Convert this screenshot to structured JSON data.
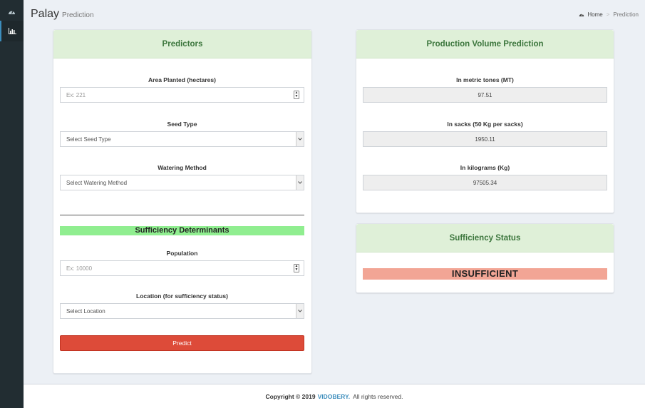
{
  "header": {
    "title": "Palay",
    "subtitle": "Prediction",
    "breadcrumb": {
      "home": "Home",
      "current": "Prediction"
    }
  },
  "sidebar": {
    "items": [
      {
        "icon": "dashboard-icon"
      },
      {
        "icon": "bar-chart-icon",
        "active": true
      }
    ]
  },
  "predictors": {
    "title": "Predictors",
    "area_label": "Area Planted (hectares)",
    "area_placeholder": "Ex: 221",
    "seed_label": "Seed Type",
    "seed_value": "Select Seed Type",
    "watering_label": "Watering Method",
    "watering_value": "Select Watering Method",
    "sufficiency_heading": "Sufficiency Determinants",
    "population_label": "Population",
    "population_placeholder": "Ex: 10000",
    "location_label": "Location (for sufficiency status)",
    "location_value": "Select Location",
    "predict_label": "Predict"
  },
  "production": {
    "title": "Production Volume Prediction",
    "mt_label": "In metric tones (MT)",
    "mt_value": "97.51",
    "sacks_label": "In sacks (50 Kg per sacks)",
    "sacks_value": "1950.11",
    "kg_label": "In kilograms (Kg)",
    "kg_value": "97505.34"
  },
  "sufficiency": {
    "title": "Sufficiency Status",
    "status": "INSUFFICIENT",
    "status_color": "#f2a595"
  },
  "footer": {
    "copyright": "Copyright © 2019",
    "brand": "VIDOBERY.",
    "rights": "All rights reserved."
  },
  "colors": {
    "accent": "#3c8dbc",
    "box_header": "#dff0d8",
    "predict_button": "#dd4b39",
    "sufficiency_bar": "#90ee90"
  }
}
